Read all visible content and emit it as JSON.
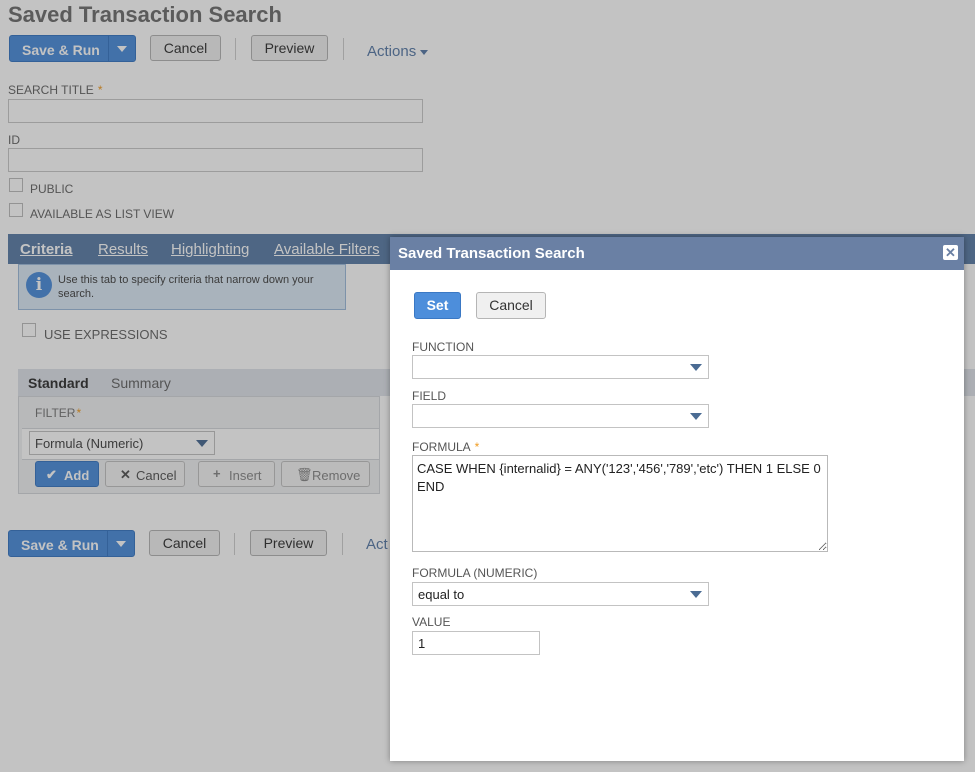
{
  "page": {
    "title": "Saved Transaction Search",
    "toolbar": {
      "save_run": "Save & Run",
      "cancel": "Cancel",
      "preview": "Preview",
      "actions": "Actions"
    },
    "search_title_label": "SEARCH TITLE",
    "required_mark": "*",
    "id_label": "ID",
    "public_label": "PUBLIC",
    "list_view_label": "AVAILABLE AS LIST VIEW",
    "tabs": [
      "Criteria",
      "Results",
      "Highlighting",
      "Available Filters"
    ],
    "info_text": "Use this tab to specify criteria that narrow down your search.",
    "use_expressions_label": "USE EXPRESSIONS",
    "subtabs": [
      "Standard",
      "Summary"
    ],
    "filter_label": "FILTER",
    "filter_value": "Formula (Numeric)",
    "row_buttons": {
      "add": "Add",
      "cancel": "Cancel",
      "insert": "Insert",
      "remove": "Remove"
    },
    "bottom_toolbar": {
      "save_run": "Save & Run",
      "cancel": "Cancel",
      "preview": "Preview",
      "actions_partial": "Act"
    }
  },
  "modal": {
    "title": "Saved Transaction Search",
    "set_button": "Set",
    "cancel_button": "Cancel",
    "function_label": "FUNCTION",
    "function_value": "",
    "field_label": "FIELD",
    "field_value": "",
    "formula_label": "FORMULA",
    "formula_value": "CASE WHEN {internalid} = ANY('123','456','789','etc') THEN 1 ELSE 0 END",
    "formula_numeric_label": "FORMULA (NUMERIC)",
    "formula_numeric_value": "equal to",
    "value_label": "VALUE",
    "value_value": "1"
  },
  "colors": {
    "primary": "#4d8edb",
    "tab_bar": "#5e7fa8",
    "modal_header": "#6a80a4",
    "required": "#f09c22"
  }
}
